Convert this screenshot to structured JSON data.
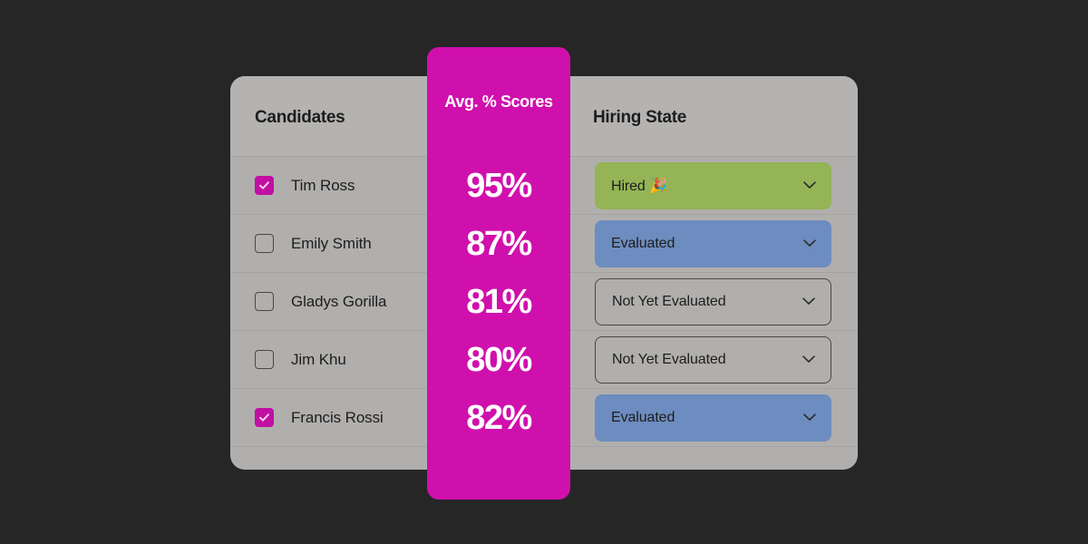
{
  "theme": {
    "page_background": "#262626",
    "card_background": "#b1afad",
    "card_header_background": "#b5b3b1",
    "divider": "#a5a3a1",
    "accent_magenta": "#d010ac",
    "checkbox_checked": "#c20fa3",
    "pill_hired_green": "#94b455",
    "pill_evaluated_blue": "#6d8cbf",
    "text_dark": "#1d1d1d",
    "text_light": "#ffffff"
  },
  "table": {
    "columns": {
      "candidates": "Candidates",
      "scores": "Avg. % Scores",
      "hiring_state": "Hiring State"
    },
    "rows": [
      {
        "name": "Tim Ross",
        "selected": true,
        "score": "95%",
        "state": "Hired 🎉",
        "state_style": "hired"
      },
      {
        "name": "Emily Smith",
        "selected": false,
        "score": "87%",
        "state": "Evaluated",
        "state_style": "evaluated"
      },
      {
        "name": "Gladys Gorilla",
        "selected": false,
        "score": "81%",
        "state": "Not Yet Evaluated",
        "state_style": "notyet"
      },
      {
        "name": "Jim Khu",
        "selected": false,
        "score": "80%",
        "state": "Not Yet Evaluated",
        "state_style": "notyet"
      },
      {
        "name": "Francis Rossi",
        "selected": true,
        "score": "82%",
        "state": "Evaluated",
        "state_style": "evaluated"
      }
    ]
  },
  "icons": {
    "checkmark": "check-icon",
    "dropdown": "chevron-down-icon"
  }
}
